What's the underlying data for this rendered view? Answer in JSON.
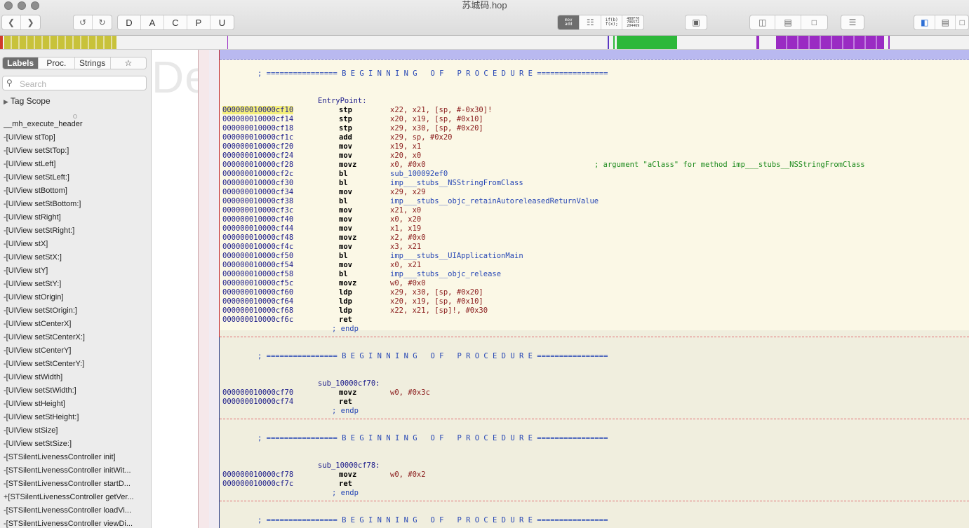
{
  "window": {
    "title": "苏城码.hop"
  },
  "toolbar": {
    "nav_back_icon": "chevron-left-icon",
    "nav_forward_icon": "chevron-right-icon",
    "undo_icon": "undo-icon",
    "redo_icon": "redo-icon",
    "type_buttons": [
      "D",
      "A",
      "C",
      "P",
      "U"
    ],
    "mode_mov_line1": "mov",
    "mode_mov_line2": "add",
    "mode_pseudo_line1": "if(b)",
    "mode_pseudo_line2": "f(x);",
    "mode_hex_lines": [
      "488F70",
      "706572",
      "204469"
    ]
  },
  "sidebar": {
    "tabs": [
      "Labels",
      "Proc.",
      "Strings",
      "☆"
    ],
    "active_tab": "Labels",
    "search_placeholder": "Search",
    "tag_scope": "Tag Scope",
    "items": [
      "__mh_execute_header",
      "-[UIView stTop]",
      "-[UIView setStTop:]",
      "-[UIView stLeft]",
      "-[UIView setStLeft:]",
      "-[UIView stBottom]",
      "-[UIView setStBottom:]",
      "-[UIView stRight]",
      "-[UIView setStRight:]",
      "-[UIView stX]",
      "-[UIView setStX:]",
      "-[UIView stY]",
      "-[UIView setStY:]",
      "-[UIView stOrigin]",
      "-[UIView setStOrigin:]",
      "-[UIView stCenterX]",
      "-[UIView setStCenterX:]",
      "-[UIView stCenterY]",
      "-[UIView setStCenterY:]",
      "-[UIView stWidth]",
      "-[UIView setStWidth:]",
      "-[UIView stHeight]",
      "-[UIView setStHeight:]",
      "-[UIView stSize]",
      "-[UIView setStSize:]",
      "-[STSilentLivenessController init]",
      "-[STSilentLivenessController initWit...",
      "-[STSilentLivenessController startD...",
      "+[STSilentLivenessController getVer...",
      "-[STSilentLivenessController loadVi...",
      "-[STSilentLivenessController viewDi..."
    ]
  },
  "listing": {
    "watermark": "Demo Version",
    "banner": "; ================ B E G I N N I N G   O F   P R O C E D U R E ================",
    "endp": "; endp",
    "proc1": {
      "label": "EntryPoint:",
      "lines": [
        {
          "addr": "000000010000cf10",
          "mn": "stp",
          "op": "x22, x21, [sp, #-0x30]!"
        },
        {
          "addr": "000000010000cf14",
          "mn": "stp",
          "op": "x20, x19, [sp, #0x10]"
        },
        {
          "addr": "000000010000cf18",
          "mn": "stp",
          "op": "x29, x30, [sp, #0x20]"
        },
        {
          "addr": "000000010000cf1c",
          "mn": "add",
          "op": "x29, sp, #0x20"
        },
        {
          "addr": "000000010000cf20",
          "mn": "mov",
          "op": "x19, x1"
        },
        {
          "addr": "000000010000cf24",
          "mn": "mov",
          "op": "x20, x0"
        },
        {
          "addr": "000000010000cf28",
          "mn": "movz",
          "op": "x0, #0x0",
          "comment": "; argument \"aClass\" for method imp___stubs__NSStringFromClass"
        },
        {
          "addr": "000000010000cf2c",
          "mn": "bl",
          "sym": "sub_100092ef0"
        },
        {
          "addr": "000000010000cf30",
          "mn": "bl",
          "sym": "imp___stubs__NSStringFromClass"
        },
        {
          "addr": "000000010000cf34",
          "mn": "mov",
          "op": "x29, x29"
        },
        {
          "addr": "000000010000cf38",
          "mn": "bl",
          "sym": "imp___stubs__objc_retainAutoreleasedReturnValue"
        },
        {
          "addr": "000000010000cf3c",
          "mn": "mov",
          "op": "x21, x0"
        },
        {
          "addr": "000000010000cf40",
          "mn": "mov",
          "op": "x0, x20"
        },
        {
          "addr": "000000010000cf44",
          "mn": "mov",
          "op": "x1, x19"
        },
        {
          "addr": "000000010000cf48",
          "mn": "movz",
          "op": "x2, #0x0"
        },
        {
          "addr": "000000010000cf4c",
          "mn": "mov",
          "op": "x3, x21"
        },
        {
          "addr": "000000010000cf50",
          "mn": "bl",
          "sym": "imp___stubs__UIApplicationMain"
        },
        {
          "addr": "000000010000cf54",
          "mn": "mov",
          "op": "x0, x21"
        },
        {
          "addr": "000000010000cf58",
          "mn": "bl",
          "sym": "imp___stubs__objc_release"
        },
        {
          "addr": "000000010000cf5c",
          "mn": "movz",
          "op": "w0, #0x0"
        },
        {
          "addr": "000000010000cf60",
          "mn": "ldp",
          "op": "x29, x30, [sp, #0x20]"
        },
        {
          "addr": "000000010000cf64",
          "mn": "ldp",
          "op": "x20, x19, [sp, #0x10]"
        },
        {
          "addr": "000000010000cf68",
          "mn": "ldp",
          "op": "x22, x21, [sp]!, #0x30"
        },
        {
          "addr": "000000010000cf6c",
          "mn": "ret",
          "op": ""
        }
      ]
    },
    "proc2": {
      "label": "sub_10000cf70:",
      "lines": [
        {
          "addr": "000000010000cf70",
          "mn": "movz",
          "op": "w0, #0x3c"
        },
        {
          "addr": "000000010000cf74",
          "mn": "ret",
          "op": ""
        }
      ]
    },
    "proc3": {
      "label": "sub_10000cf78:",
      "lines": [
        {
          "addr": "000000010000cf78",
          "mn": "movz",
          "op": "w0, #0x2"
        },
        {
          "addr": "000000010000cf7c",
          "mn": "ret",
          "op": ""
        }
      ]
    }
  },
  "colors": {
    "navbar_code": "#c8c23a",
    "navbar_green": "#2db83a",
    "navbar_purple": "#9a2bc3",
    "selected_band": "#fbf8e6",
    "address": "#1b1b8a",
    "comment": "#1c8a1c"
  }
}
